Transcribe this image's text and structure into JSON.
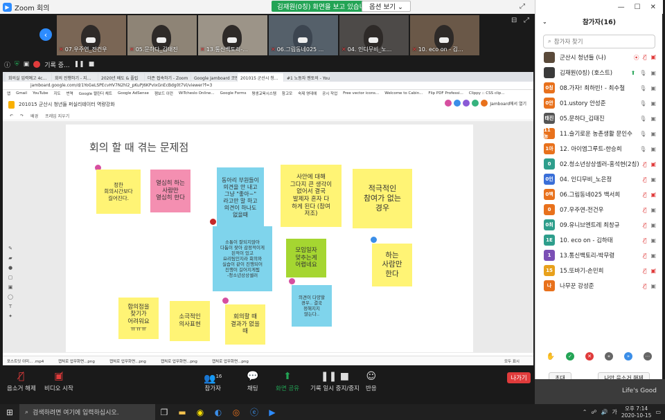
{
  "window": {
    "title": "Zoom 회의"
  },
  "share": {
    "banner": "김재원(0칭) 화면을 보고 있습니다.",
    "view_options": "옵션 보기 ⌄"
  },
  "thumbnails": [
    {
      "name": "07.우주연_전건우"
    },
    {
      "name": "05.문하다_김태진"
    },
    {
      "name": "13.통신백토리-..."
    },
    {
      "name": "06.그림동네025 ..."
    },
    {
      "name": "04. 인디무비_노..."
    },
    {
      "name": "10. eco on - 김..."
    }
  ],
  "recording": {
    "label": "기록 중..."
  },
  "browser": {
    "tabs": [
      "회의실 입력예고 4c...",
      "회의 진행하기 - 지...",
      "2020년 배도 & 플립",
      "더존 접속하기 - Zoom",
      "Google Jamboard 코멘트 입",
      "201015 군산시 청...",
      "#1 노동자 멘토의 - YouTube"
    ],
    "url": "jamboard.google.com/d/1YoGeLSPEcvHV7N2hl2_pKuPJ6KPvIxGnEcBdg0t7Vi/viewer?f=3",
    "bookmarks": [
      "앱",
      "Gmail",
      "YouTube",
      "지도",
      "번역",
      "Google 캘린더 체트",
      "Google AdSense",
      "잼보드 이런",
      "WiTcheslo Online...",
      "Google Forms",
      "평생교육시스템",
      "참고모",
      "숙제 영데예",
      "공시 작업",
      "Free vector icons...",
      "Welcome to Cabin...",
      "Flip PDF Professi...",
      "Clippy :: CSS clip..."
    ],
    "board_title": "201015 군산시 청년들 퍼실리테이터 역량강화",
    "tool_labels": [
      "배경",
      "프레임 지우기"
    ],
    "jb_share": "Jamboard에서 열기",
    "downloads": [
      "포스트잇 이미... .mp4",
      "캡쳐로 업무화면...png",
      "캡쳐로 업무화면...png",
      "캡쳐로 업무화면...png",
      "캡쳐로 업무화면...png"
    ],
    "show_all": "모두 표시"
  },
  "board": {
    "title": "회의 할 때 겪는 문제점",
    "notes": [
      {
        "text": "정한\n회의시간보다\n길어진다."
      },
      {
        "text": "열심히 하는\n사람만\n열심히 한다"
      },
      {
        "text": "동아리 부원들이\n의견을 안 내고\n그냥 \"좋아~\"\n라고만 말 하고\n의견이 하나도\n없을때"
      },
      {
        "text": "사안에 대해\n그다지 큰 생각이\n없어서 결국\n발제자 혼자 다\n하게 된다 (참여\n저조)"
      },
      {
        "text": "적극적인\n참여가 없는\n경우"
      },
      {
        "text": "소통이 잘되지않아\n다툼이 잦아 감정적이게\n된적이 있고\n요리팀인지라 회의와\n실습이 같이 진행되어\n진행이 길어지게됨\n-청소년상상셀러"
      },
      {
        "text": "모임일자\n맞추는게\n어렵네요"
      },
      {
        "text": "하는\n사람만\n한다"
      },
      {
        "text": "의견이 다양할\n경우.. 결국\n정해지지\n않는다.."
      },
      {
        "text": "합의점을\n찾기가\n어려워요\nㅠㅠㅠ"
      },
      {
        "text": "소극적인\n의사표현"
      },
      {
        "text": "회의할 때\n결과가 없을\n때"
      }
    ]
  },
  "toolbar": {
    "audio": "음소거 해제",
    "video": "비디오 시작",
    "participants": "참가자",
    "participants_count": "16",
    "chat": "채팅",
    "share": "화면 공유",
    "pause": "기록 일시 중지/중지",
    "reactions": "반응",
    "leave": "나가기"
  },
  "panel": {
    "title": "참가자(16)",
    "search_placeholder": "참가자 찾기",
    "participants": [
      {
        "avatar": "",
        "color": "#5a4a3a",
        "name": "군산시 청년들 (나)"
      },
      {
        "avatar": "",
        "color": "#3a3a3a",
        "name": "김재원(0칭) (호스트)"
      },
      {
        "avatar": "0칭",
        "color": "#e8711c",
        "name": "08.가자! 최하빈! - 최수철"
      },
      {
        "avatar": "0안",
        "color": "#e8711c",
        "name": "01.ustory 안성준"
      },
      {
        "avatar": "태진",
        "color": "#555555",
        "name": "05.문하다_김태진"
      },
      {
        "avatar": "11농",
        "color": "#e8711c",
        "name": "11.슬기로운 농촌생활 문인수"
      },
      {
        "avatar": "1아",
        "color": "#e8711c",
        "name": "12. 아이엠그루트-한승희"
      },
      {
        "avatar": "0",
        "color": "#2e9e8c",
        "name": "02.청소년상상셀러-홍석현(2칭)"
      },
      {
        "avatar": "0인",
        "color": "#3a6fd8",
        "name": "04. 인디무비_노은정"
      },
      {
        "avatar": "0백",
        "color": "#e8711c",
        "name": "06.그림동네025 백서희"
      },
      {
        "avatar": "0",
        "color": "#e8711c",
        "name": "07.우주연-전건우"
      },
      {
        "avatar": "0최",
        "color": "#2e9e8c",
        "name": "09.유니브엔트레 최창규"
      },
      {
        "avatar": "1E",
        "color": "#2e9e8c",
        "name": "10. eco on - 김하태"
      },
      {
        "avatar": "1",
        "color": "#7b4fb5",
        "name": "13.통신백토리-박무령"
      },
      {
        "avatar": "15",
        "color": "#e8a11c",
        "name": "15.또바기-손민희"
      },
      {
        "avatar": "나",
        "color": "#e8711c",
        "name": "나무꾼 강성준"
      }
    ],
    "invite": "초대",
    "unmute_me": "나만 음소거 해제"
  },
  "desktop": {
    "wallpaper_text": "Life's Good"
  },
  "taskbar": {
    "search": "검색하려면 여기에 입력하십시오.",
    "ime": "가",
    "time": "오후 7:14",
    "date": "2020-10-15"
  }
}
